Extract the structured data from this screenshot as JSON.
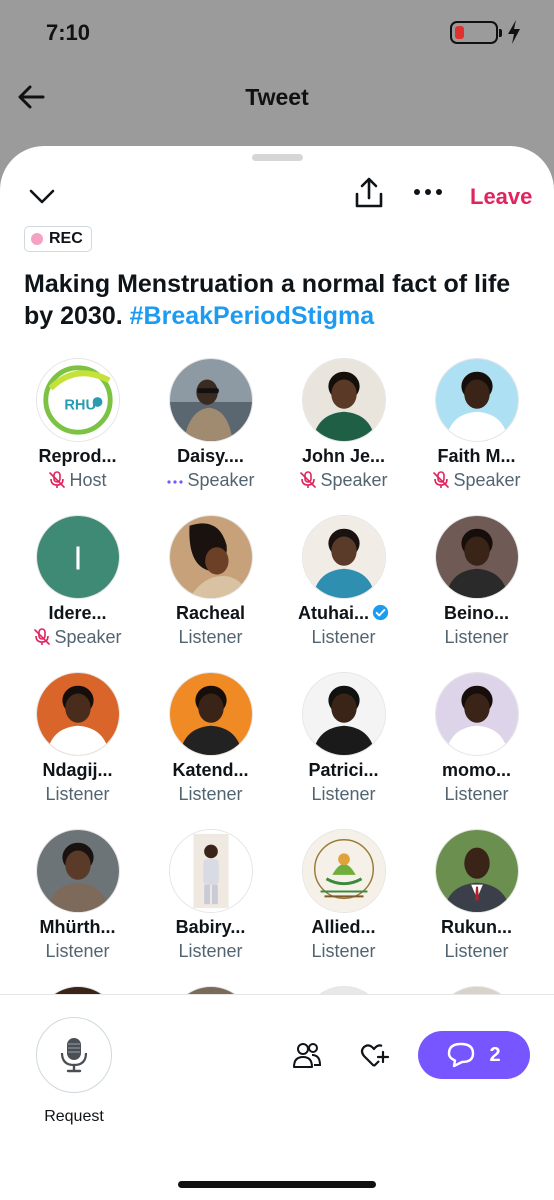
{
  "status": {
    "time": "7:10"
  },
  "header": {
    "title": "Tweet"
  },
  "sheet": {
    "leave_label": "Leave",
    "rec_label": "REC",
    "title_text": "Making Menstruation a normal fact of life by 2030. ",
    "title_hashtag": "#BreakPeriodStigma"
  },
  "participants": [
    {
      "name": "Reprod...",
      "role": "Host",
      "role_icon": "mic-off-icon",
      "avatar": "logo-rhu",
      "logo_text": "RHU"
    },
    {
      "name": "Daisy....",
      "role": "Speaker",
      "role_icon": "speaking-dots-icon",
      "avatar": "photo"
    },
    {
      "name": "John Je...",
      "role": "Speaker",
      "role_icon": "mic-off-icon",
      "avatar": "photo"
    },
    {
      "name": "Faith M...",
      "role": "Speaker",
      "role_icon": "mic-off-icon",
      "avatar": "photo"
    },
    {
      "name": "Idere...",
      "role": "Speaker",
      "role_icon": "mic-off-icon",
      "avatar": "initial",
      "initial": "I"
    },
    {
      "name": "Racheal",
      "role": "Listener",
      "avatar": "photo"
    },
    {
      "name": "Atuhai...",
      "role": "Listener",
      "avatar": "photo",
      "verified": true
    },
    {
      "name": "Beino...",
      "role": "Listener",
      "avatar": "photo"
    },
    {
      "name": "Ndagij...",
      "role": "Listener",
      "avatar": "photo"
    },
    {
      "name": "Katend...",
      "role": "Listener",
      "avatar": "photo"
    },
    {
      "name": "Patrici...",
      "role": "Listener",
      "avatar": "photo"
    },
    {
      "name": "momo...",
      "role": "Listener",
      "avatar": "photo"
    },
    {
      "name": "Mhürth...",
      "role": "Listener",
      "avatar": "photo"
    },
    {
      "name": "Babiry...",
      "role": "Listener",
      "avatar": "photo"
    },
    {
      "name": "Allied...",
      "role": "Listener",
      "avatar": "logo"
    },
    {
      "name": "Rukun...",
      "role": "Listener",
      "avatar": "photo"
    }
  ],
  "bottom": {
    "request_label": "Request",
    "comments_count": "2"
  },
  "colors": {
    "leave": "#e0245e",
    "hashtag": "#1d9bf0",
    "comments_button": "#7856ff",
    "mic_off": "#e0245e",
    "speaking_dots": "#7856ff",
    "rec_dot": "#f4a1c3",
    "battery_low": "#e0312f",
    "verified": "#1d9bf0"
  },
  "icons": {
    "back": "arrow-left-icon",
    "collapse": "chevron-down-icon",
    "share": "share-icon",
    "more": "more-dots-icon",
    "request": "microphone-icon",
    "people": "people-icon",
    "react": "heart-plus-icon",
    "comments": "comment-bubble-icon"
  }
}
